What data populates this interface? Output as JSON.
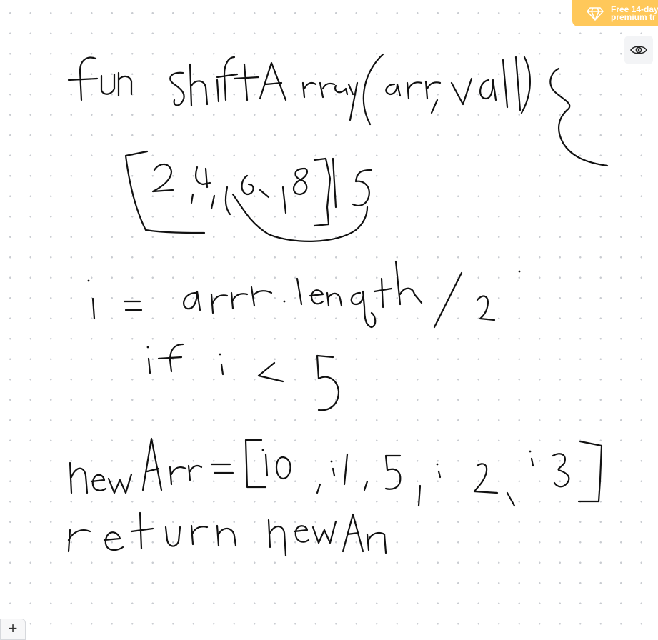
{
  "banner": {
    "line1": "Free 14-day",
    "line2": "premium tr",
    "icon": "diamond-icon",
    "color": "#ffc85a"
  },
  "toolbar": {
    "preview_icon": "eye-icon",
    "add_icon": "plus-icon",
    "add_label": "+"
  },
  "canvas": {
    "background": "#ffffff",
    "dot_color": "#c9ccd1",
    "ink_color": "#111111",
    "handwriting_lines": [
      "fun shiftArray(arr, val) {",
      "[2,4,6,8] 5",
      "i = arr.length / 2",
      "if i < 5",
      "newArr = [i0, i1, 5, i2, i3]",
      "return newArr"
    ]
  }
}
